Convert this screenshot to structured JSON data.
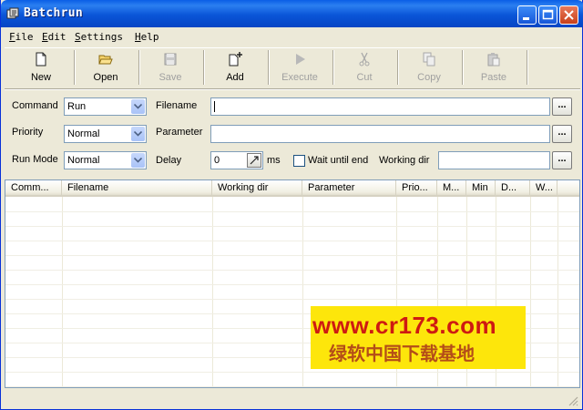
{
  "window": {
    "title": "Batchrun"
  },
  "menu": [
    "File",
    "Edit",
    "Settings",
    "Help"
  ],
  "toolbar": [
    {
      "label": "New",
      "icon": "new-document-icon",
      "enabled": true
    },
    {
      "label": "Open",
      "icon": "open-folder-icon",
      "enabled": true
    },
    {
      "label": "Save",
      "icon": "save-disk-icon",
      "enabled": false
    },
    {
      "label": "Add",
      "icon": "add-document-icon",
      "enabled": true
    },
    {
      "label": "Execute",
      "icon": "play-icon",
      "enabled": false
    },
    {
      "label": "Cut",
      "icon": "scissors-icon",
      "enabled": false
    },
    {
      "label": "Copy",
      "icon": "copy-icon",
      "enabled": false
    },
    {
      "label": "Paste",
      "icon": "paste-icon",
      "enabled": false
    }
  ],
  "form": {
    "command_label": "Command",
    "command_value": "Run",
    "priority_label": "Priority",
    "priority_value": "Normal",
    "runmode_label": "Run Mode",
    "runmode_value": "Normal",
    "filename_label": "Filename",
    "filename_value": "",
    "parameter_label": "Parameter",
    "parameter_value": "",
    "delay_label": "Delay",
    "delay_value": "0",
    "delay_unit": "ms",
    "wait_label": "Wait until end",
    "wait_checked": false,
    "workdir_label": "Working dir",
    "workdir_value": "",
    "browse_label": "..."
  },
  "table": {
    "columns": [
      "Comm...",
      "Filename",
      "Working dir",
      "Parameter",
      "Prio...",
      "M...",
      "Min",
      "D...",
      "W..."
    ],
    "rows": []
  },
  "watermark": {
    "url": "www.cr173.com",
    "text": "绿软中国下载基地"
  },
  "colors": {
    "title_bar": "#0a55d8",
    "face": "#ece9d8",
    "watermark_bg": "#fde60b",
    "watermark_url": "#ce1a12"
  }
}
